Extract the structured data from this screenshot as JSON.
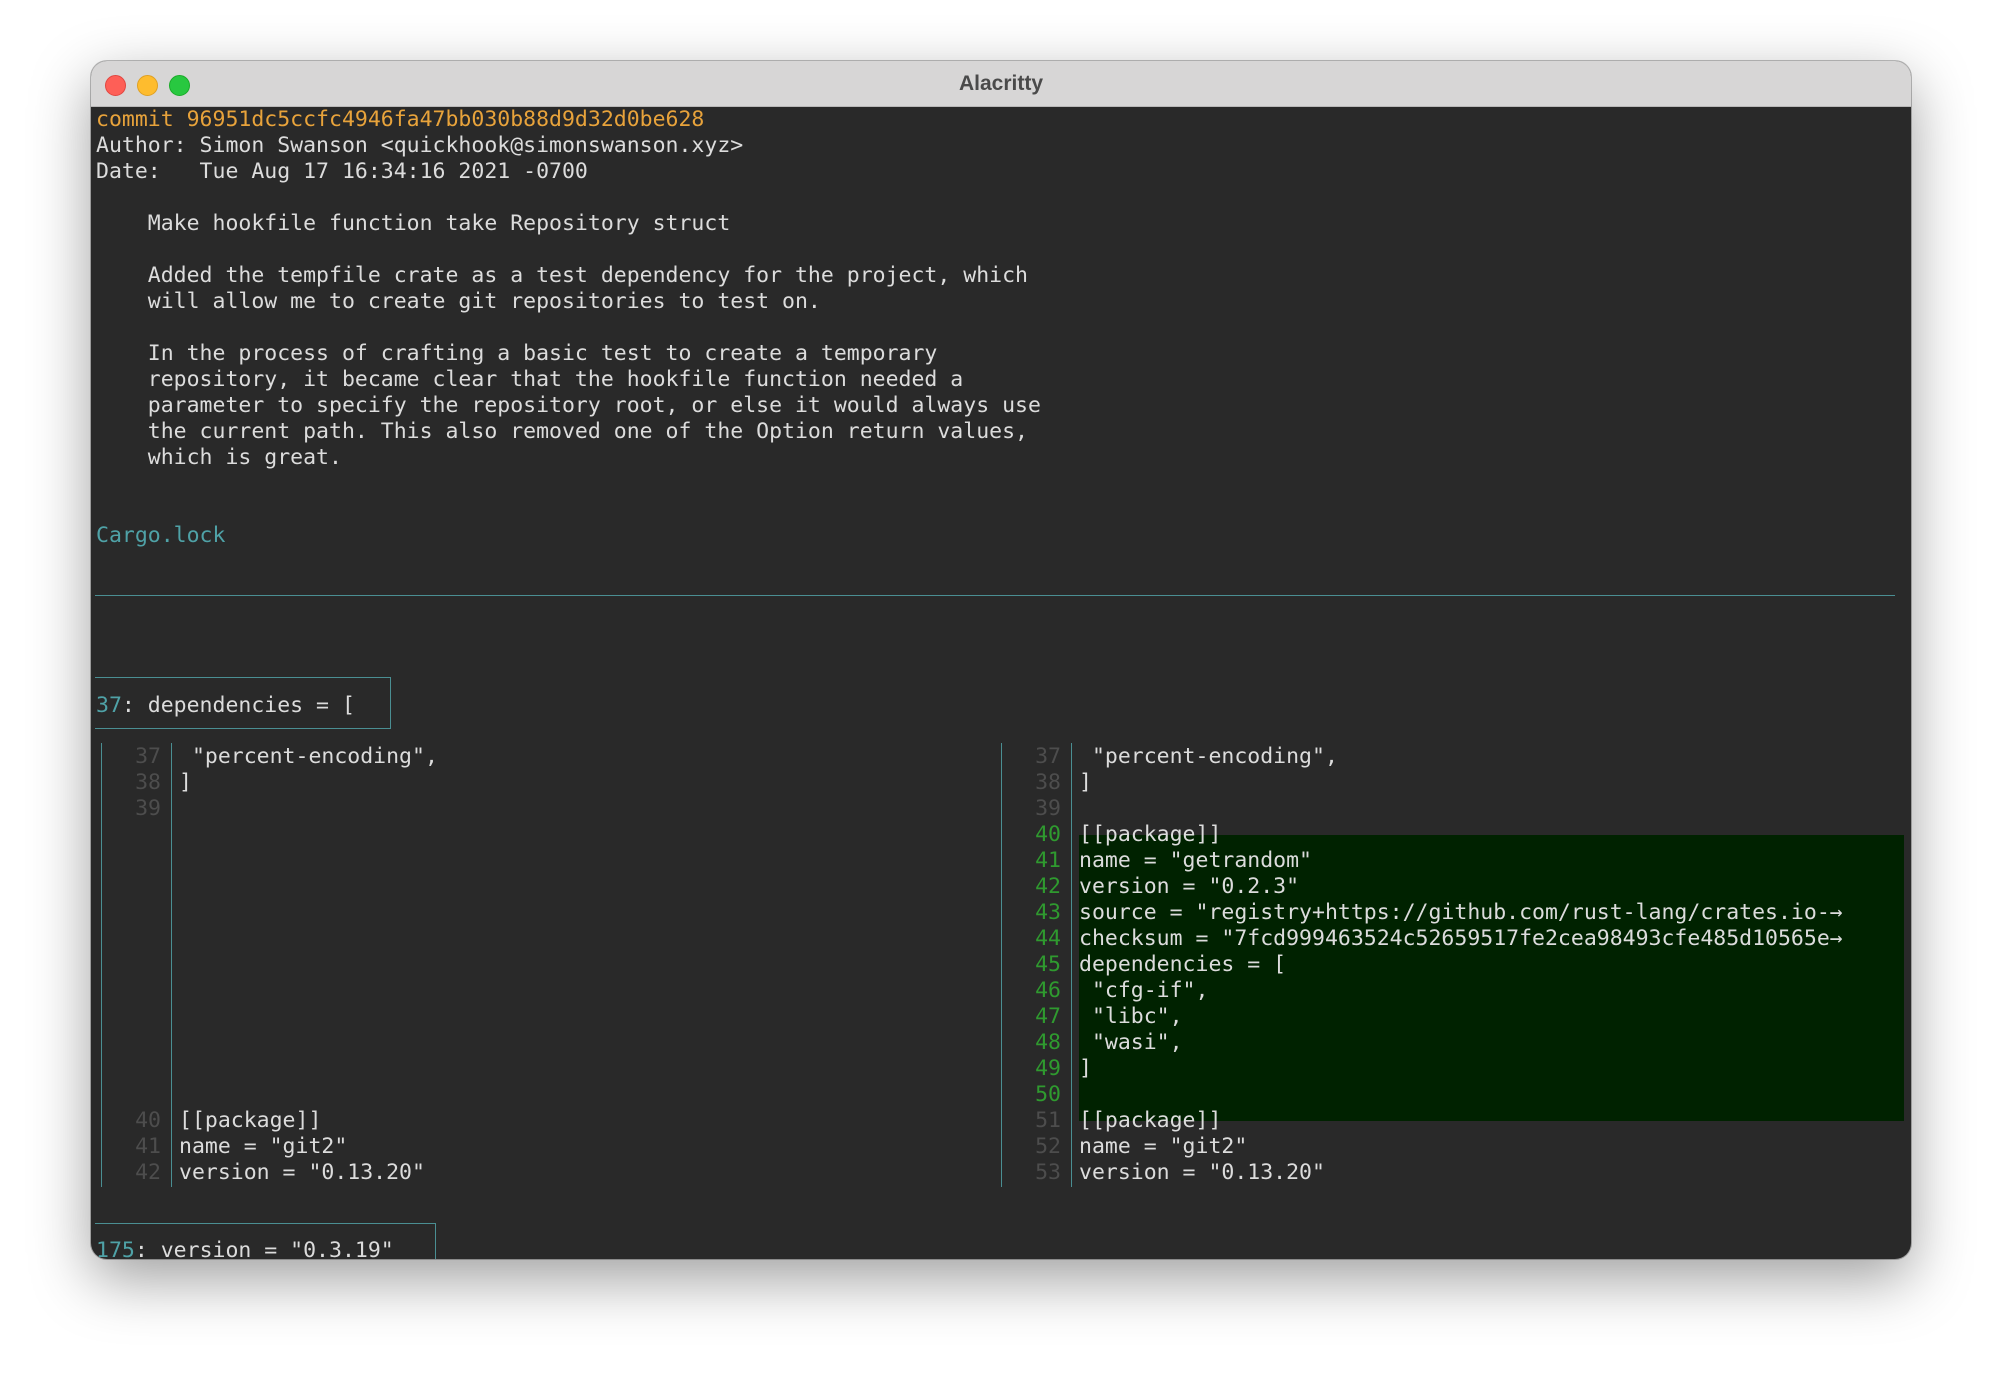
{
  "window": {
    "title": "Alacritty"
  },
  "commit": {
    "hash_line": "commit 96951dc5ccfc4946fa47bb030b88d9d32d0be628",
    "author_line": "Author: Simon Swanson <quickhook@simonswanson.xyz>",
    "date_line": "Date:   Tue Aug 17 16:34:16 2021 -0700",
    "message": [
      "    Make hookfile function take Repository struct",
      "",
      "    Added the tempfile crate as a test dependency for the project, which",
      "    will allow me to create git repositories to test on.",
      "",
      "    In the process of crafting a basic test to create a temporary",
      "    repository, it became clear that the hookfile function needed a",
      "    parameter to specify the repository root, or else it would always use",
      "    the current path. This also removed one of the Option return values,",
      "    which is great."
    ]
  },
  "file": {
    "name": "Cargo.lock"
  },
  "hunk1": {
    "line_no": "37",
    "context": ": dependencies = ["
  },
  "left_pane": {
    "lines": [
      {
        "n": "37",
        "text": " \"percent-encoding\","
      },
      {
        "n": "38",
        "text": "]"
      },
      {
        "n": "39",
        "text": ""
      },
      {
        "n": "40",
        "text": "[[package]]"
      },
      {
        "n": "41",
        "text": "name = \"git2\""
      },
      {
        "n": "42",
        "text": "version = \"0.13.20\""
      }
    ]
  },
  "right_pane": {
    "lines": [
      {
        "n": "37",
        "text": " \"percent-encoding\",",
        "added": false
      },
      {
        "n": "38",
        "text": "]",
        "added": false
      },
      {
        "n": "39",
        "text": "",
        "added": false
      },
      {
        "n": "40",
        "text": "[[package]]",
        "added": true
      },
      {
        "n": "41",
        "text": "name = \"getrandom\"",
        "added": true
      },
      {
        "n": "42",
        "text": "version = \"0.2.3\"",
        "added": true
      },
      {
        "n": "43",
        "text": "source = \"registry+https://github.com/rust-lang/crates.io-→",
        "added": true
      },
      {
        "n": "44",
        "text": "checksum = \"7fcd999463524c52659517fe2cea98493cfe485d10565e→",
        "added": true
      },
      {
        "n": "45",
        "text": "dependencies = [",
        "added": true
      },
      {
        "n": "46",
        "text": " \"cfg-if\",",
        "added": true
      },
      {
        "n": "47",
        "text": " \"libc\",",
        "added": true
      },
      {
        "n": "48",
        "text": " \"wasi\",",
        "added": true
      },
      {
        "n": "49",
        "text": "]",
        "added": true
      },
      {
        "n": "50",
        "text": "",
        "added": true
      },
      {
        "n": "51",
        "text": "[[package]]",
        "added": false
      },
      {
        "n": "52",
        "text": "name = \"git2\"",
        "added": false
      },
      {
        "n": "53",
        "text": "version = \"0.13.20\"",
        "added": false
      }
    ]
  },
  "hunk2": {
    "line_no": "175",
    "context": ": version = \"0.3.19\""
  },
  "prompt": ":"
}
